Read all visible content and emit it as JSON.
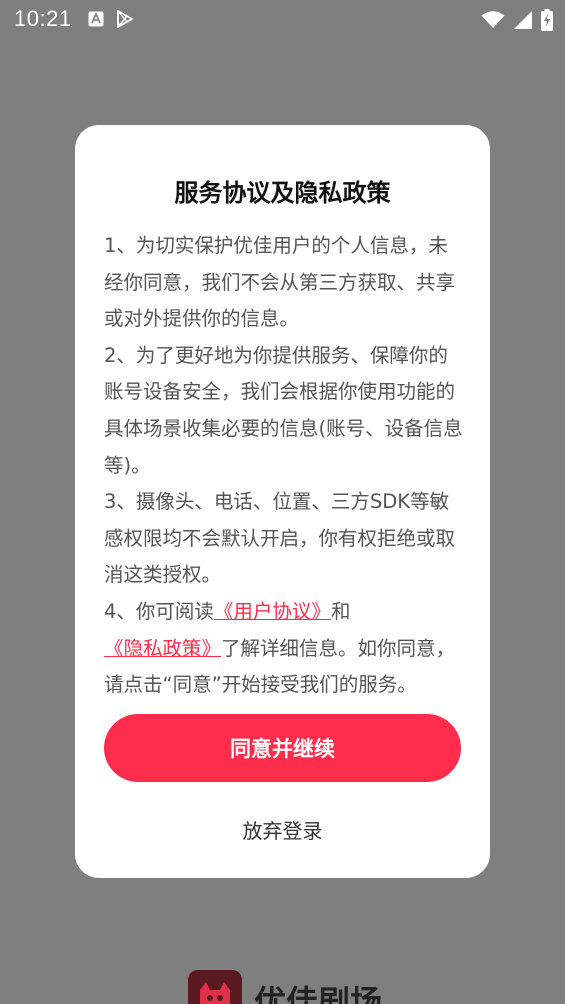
{
  "status_bar": {
    "time": "10:21",
    "left_icons": [
      "a-icon",
      "play-store-icon"
    ],
    "right_icons": [
      "wifi-icon",
      "cellular-signal-icon",
      "battery-charging-icon"
    ]
  },
  "dialog": {
    "title": "服务协议及隐私政策",
    "paragraph_1": "1、为切实保护优佳用户的个人信息，未经你同意，我们不会从第三方获取、共享或对外提供你的信息。",
    "paragraph_2": "2、为了更好地为你提供服务、保障你的账号设备安全，我们会根据你使用功能的具体场景收集必要的信息(账号、设备信息等)。",
    "paragraph_3": "3、摄像头、电话、位置、三方SDK等敏感权限均不会默认开启，你有权拒绝或取消这类授权。",
    "paragraph_4": {
      "prefix": "4、你可阅读",
      "user_agreement_link": "《用户协议》",
      "connector": "和",
      "privacy_policy_link": "《隐私政策》",
      "suffix": "了解详细信息。如你同意，请点击“同意”开始接受我们的服务。"
    },
    "agree_button_label": "同意并继续",
    "decline_label": "放弃登录"
  },
  "brand": {
    "name": "优佳剧场"
  },
  "colors": {
    "accent": "#ff2d4c",
    "overlay": "#7f7f7f",
    "dialog_background": "#ffffff"
  }
}
